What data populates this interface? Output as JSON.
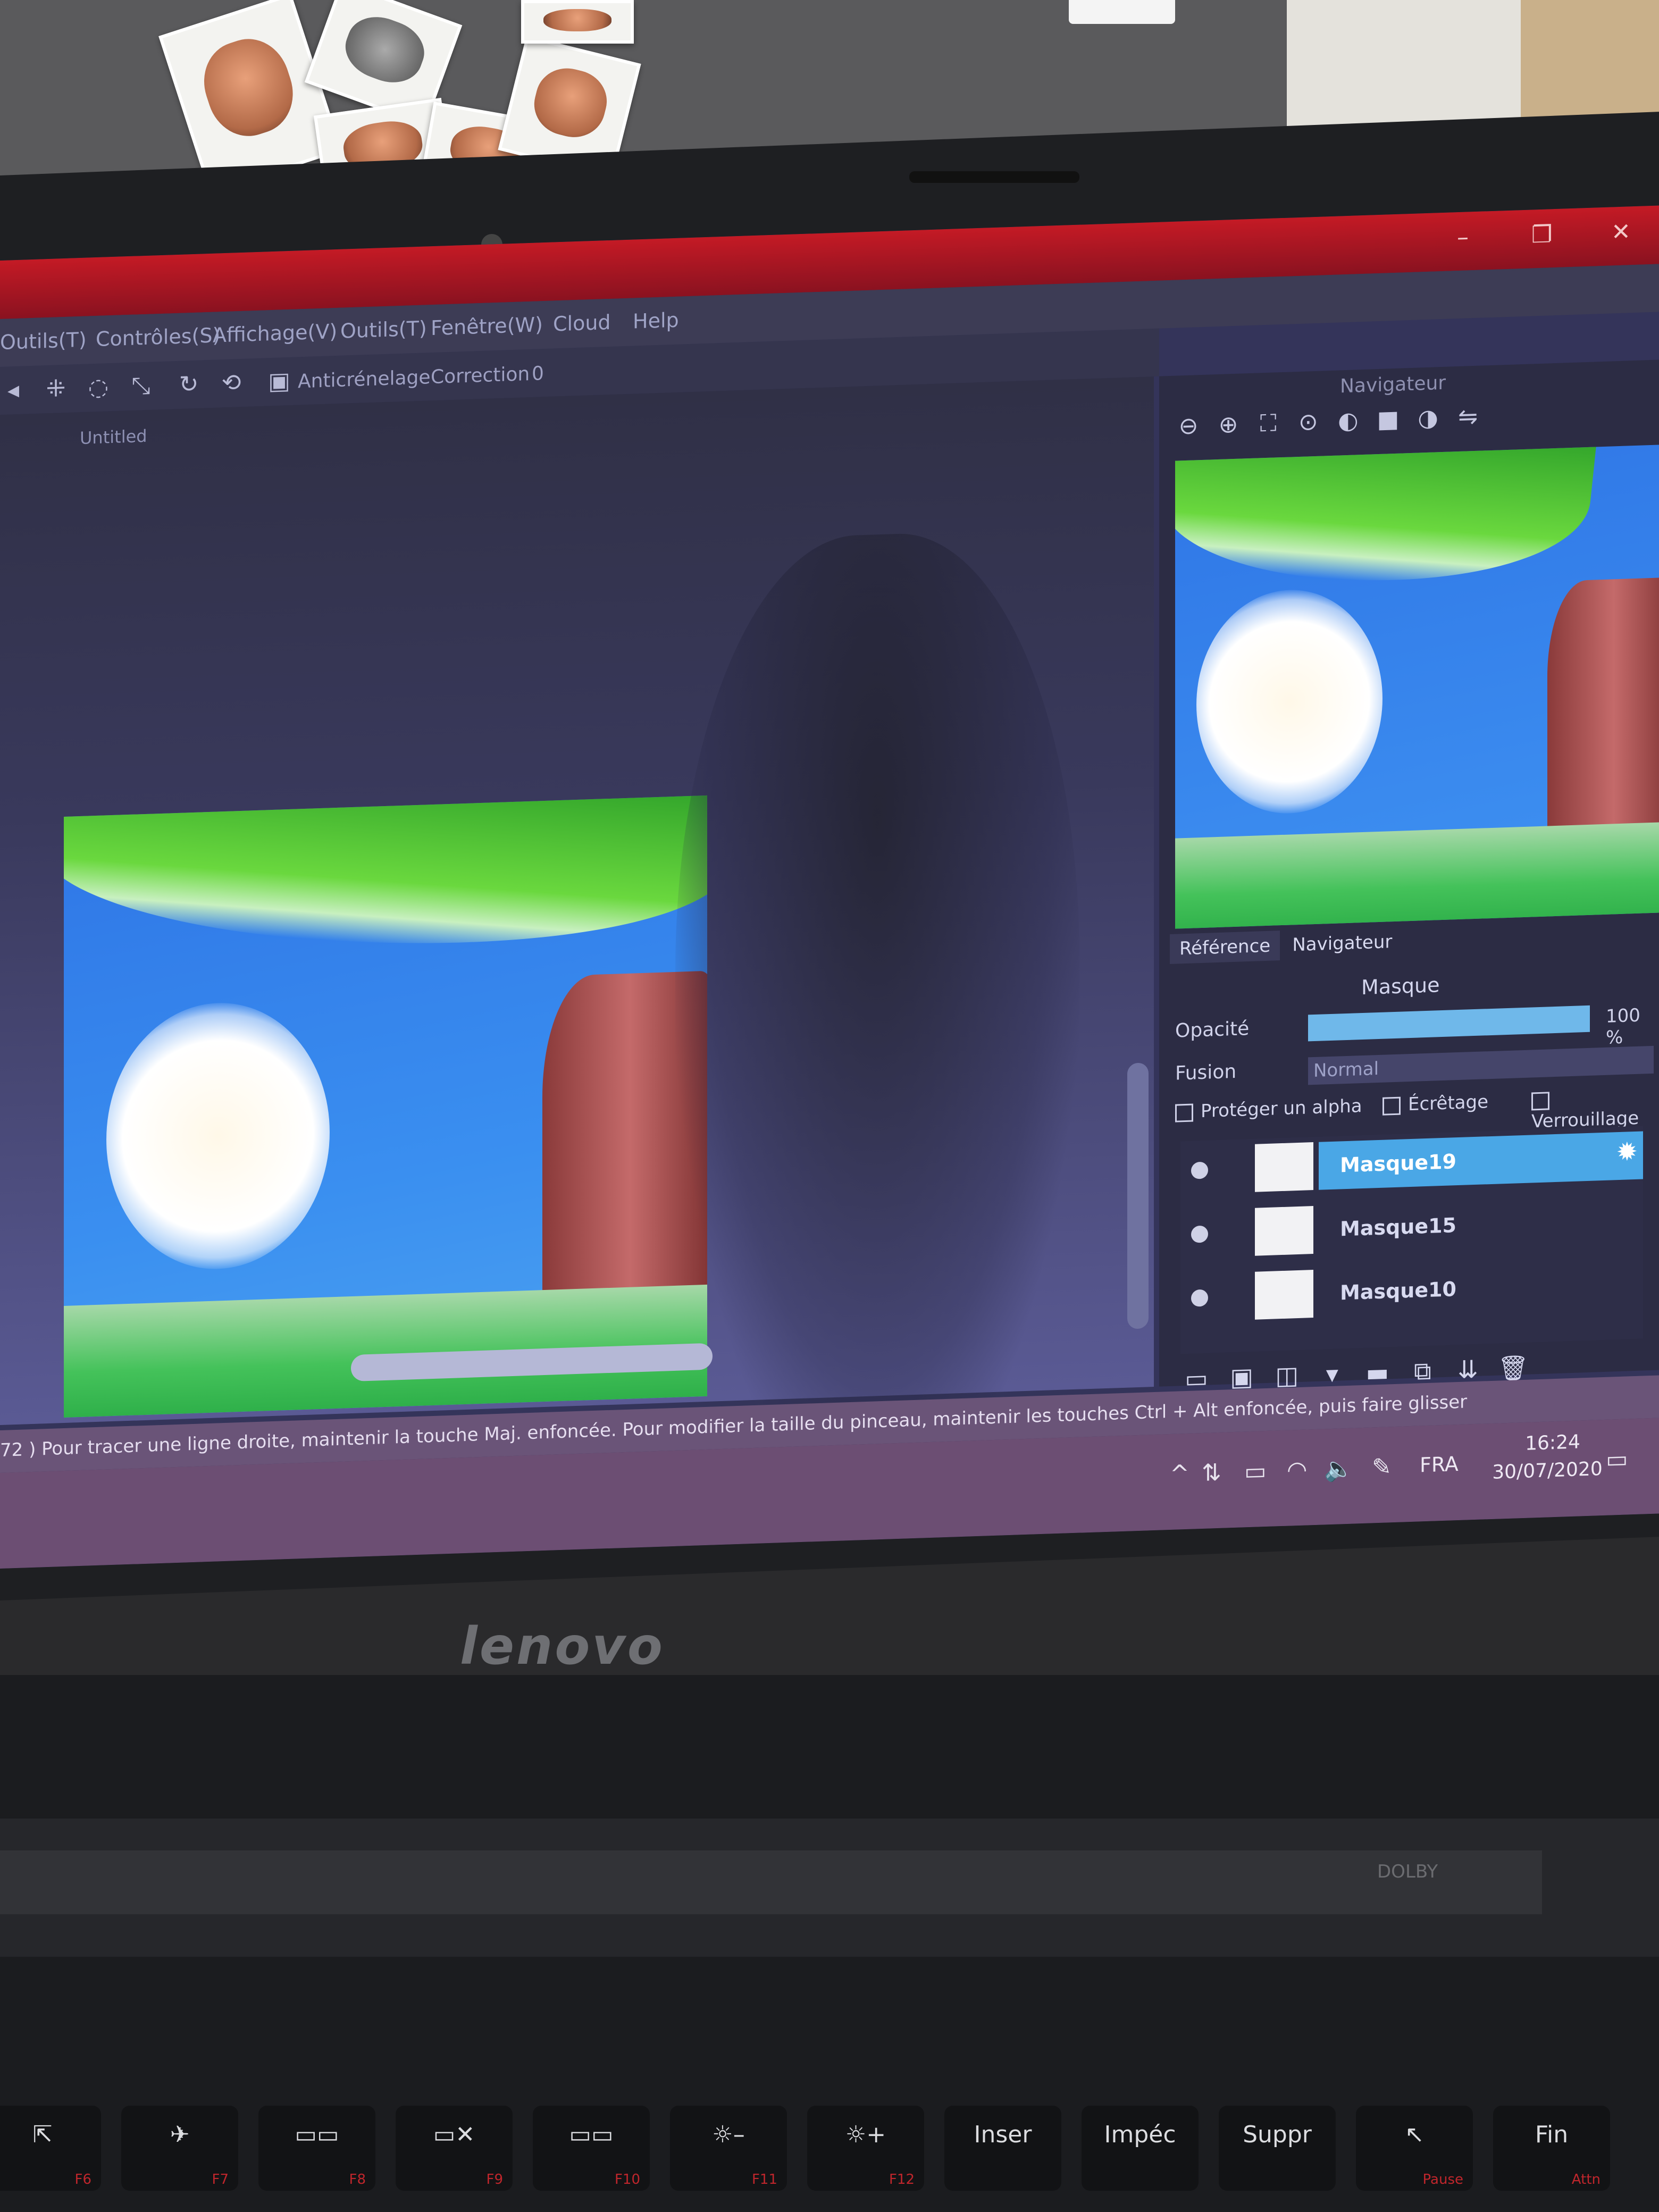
{
  "window": {
    "controls": [
      "–",
      "❐",
      "✕"
    ]
  },
  "menubar": {
    "items": [
      "Outils(T)",
      "Contrôles(S)",
      "Affichage(V)",
      "Outils(T)",
      "Fenêtre(W)",
      "Cloud",
      "Help"
    ]
  },
  "toolbar": {
    "antialias_label": "Anticrénelage",
    "correction_label": "Correction",
    "correction_value": "0"
  },
  "document": {
    "tab": "Untitled"
  },
  "navigator": {
    "title": "Navigateur"
  },
  "panel_tabs": [
    "Référence",
    "Navigateur"
  ],
  "layer_panel": {
    "title": "Masque",
    "opacity_label": "Opacité",
    "opacity_value": "100 %",
    "opacity_fraction": 1.0,
    "blend_label": "Fusion",
    "blend_value": "Normal",
    "protect_alpha_label": "Protéger un alpha",
    "clipping_label": "Écrêtage",
    "lock_label": "Verrouillage",
    "layers": [
      {
        "name": "Masque19",
        "selected": true
      },
      {
        "name": "Masque15",
        "selected": false
      },
      {
        "name": "Masque10",
        "selected": false
      }
    ]
  },
  "status_bar": {
    "text": "72 )  Pour tracer une ligne droite, maintenir la touche Maj. enfoncée. Pour modifier la taille du pinceau, maintenir les touches Ctrl + Alt enfoncée, puis faire glisser"
  },
  "taskbar": {
    "language": "FRA",
    "time": "16:24",
    "date": "30/07/2020"
  },
  "laptop": {
    "brand": "lenovo",
    "badge": "DOLBY"
  },
  "keyboard": {
    "keys": [
      {
        "label": "⇱",
        "fn": "F6"
      },
      {
        "label": "✈",
        "fn": "F7"
      },
      {
        "label": "▭▭",
        "fn": "F8"
      },
      {
        "label": "▭✕",
        "fn": "F9"
      },
      {
        "label": "▭▭",
        "fn": "F10"
      },
      {
        "label": "☼–",
        "fn": "F11"
      },
      {
        "label": "☼+",
        "fn": "F12"
      },
      {
        "label": "Inser",
        "fn": ""
      },
      {
        "label": "Impéc",
        "fn": ""
      },
      {
        "label": "Suppr",
        "fn": ""
      },
      {
        "label": "↖",
        "fn": "Pause"
      },
      {
        "label": "Fin",
        "fn": "Attn"
      }
    ]
  },
  "colors": {
    "titlebar": "#c41a25",
    "selected_layer": "#4aa7e6",
    "taskbar": "#6c4e73"
  }
}
